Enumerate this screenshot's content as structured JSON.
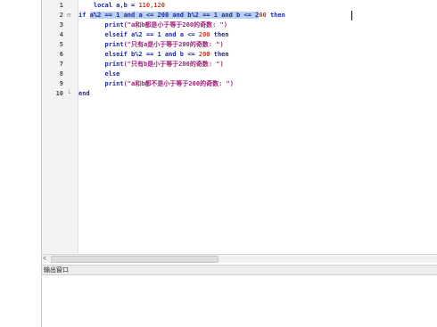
{
  "editor": {
    "lines": [
      {
        "num": "1",
        "fold": "",
        "segments": [
          {
            "t": "    local a,b = ",
            "c": "tx"
          },
          {
            "t": "110,120",
            "c": "num"
          }
        ]
      },
      {
        "num": "2",
        "fold": "⊟",
        "segments": [
          {
            "t": "if ",
            "c": "kw"
          },
          {
            "t": "a%2 == 1 and a <= 200 and b%2 == 1 and b <= 2",
            "c": "sel"
          },
          {
            "t": "00",
            "c": "num"
          },
          {
            "t": " then",
            "c": "kw"
          }
        ]
      },
      {
        "num": "3",
        "fold": "",
        "segments": [
          {
            "t": "       print",
            "c": "kw"
          },
          {
            "t": "(\"a和b都是小于等于200的奇数: \")",
            "c": "str"
          }
        ]
      },
      {
        "num": "4",
        "fold": "",
        "segments": [
          {
            "t": "       elseif a%2 == 1 and a <= ",
            "c": "kw"
          },
          {
            "t": "200",
            "c": "num"
          },
          {
            "t": " then",
            "c": "kw"
          }
        ]
      },
      {
        "num": "5",
        "fold": "",
        "segments": [
          {
            "t": "       print",
            "c": "kw"
          },
          {
            "t": "(\"只有a是小于等于200的奇数: \")",
            "c": "str"
          }
        ]
      },
      {
        "num": "6",
        "fold": "",
        "segments": [
          {
            "t": "       elseif b%2 == 1 and b <= ",
            "c": "kw"
          },
          {
            "t": "200",
            "c": "num"
          },
          {
            "t": " then",
            "c": "kw"
          }
        ]
      },
      {
        "num": "7",
        "fold": "",
        "segments": [
          {
            "t": "       print",
            "c": "kw"
          },
          {
            "t": "(\"只有b是小于等于200的奇数: \")",
            "c": "str"
          }
        ]
      },
      {
        "num": "8",
        "fold": "",
        "segments": [
          {
            "t": "       else",
            "c": "kw"
          }
        ]
      },
      {
        "num": "9",
        "fold": "",
        "segments": [
          {
            "t": "       print",
            "c": "kw"
          },
          {
            "t": "(\"a和b都不是小于等于200的奇数: \")",
            "c": "str"
          }
        ]
      },
      {
        "num": "10",
        "fold": "└",
        "segments": [
          {
            "t": "end",
            "c": "kw"
          }
        ]
      }
    ]
  },
  "output_panel": {
    "title": "输出窗口"
  },
  "scroll": {
    "left_arrow": "<"
  }
}
